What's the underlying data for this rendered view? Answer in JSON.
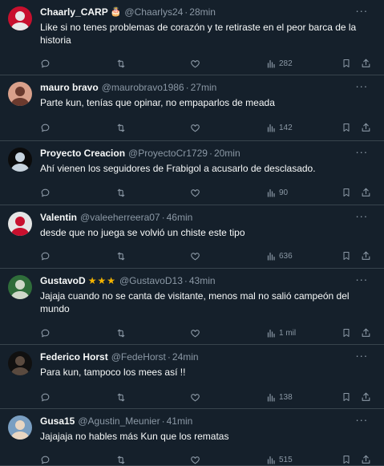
{
  "tweets": [
    {
      "name": "Chaarly_CARP",
      "badge": "🎂",
      "handle": "@Chaarlys24",
      "separator": "·",
      "time": "28min",
      "text": "Like si no tenes problemas de corazón y te retiraste en el peor barca de la historia",
      "views": "282",
      "avatar_colors": [
        "#c8102e",
        "#e8e8e8"
      ]
    },
    {
      "name": "mauro bravo",
      "badge": "",
      "handle": "@maurobravo1986",
      "separator": "·",
      "time": "27min",
      "text": "Parte kun, tenías que opinar, no empaparlos de meada",
      "views": "142",
      "avatar_colors": [
        "#d9a08b",
        "#6b3a2e"
      ]
    },
    {
      "name": "Proyecto Creacion",
      "badge": "",
      "handle": "@ProyectoCr1729",
      "separator": "·",
      "time": "20min",
      "text": "Ahí vienen los seguidores de Frabigol a acusarlo de desclasado.",
      "views": "90",
      "avatar_colors": [
        "#0b0b0b",
        "#c7d3dd"
      ]
    },
    {
      "name": "Valentin",
      "badge": "",
      "handle": "@valeeherreera07",
      "separator": "·",
      "time": "46min",
      "text": "desde que no  juega se volvió un chiste este tipo",
      "views": "636",
      "avatar_colors": [
        "#e5e5e5",
        "#c8102e"
      ]
    },
    {
      "name": "GustavoD",
      "badge": "★★★",
      "handle": "@GustavoD13",
      "separator": "·",
      "time": "43min",
      "text": "Jajaja cuando no se canta de visitante, menos mal no salió campeón del mundo",
      "views": "1 mil",
      "avatar_colors": [
        "#2f6d3a",
        "#cfd9c9"
      ]
    },
    {
      "name": "Federico Horst",
      "badge": "",
      "handle": "@FedeHorst",
      "separator": "·",
      "time": "24min",
      "text": "Para kun, tampoco los mees así !!",
      "views": "138",
      "avatar_colors": [
        "#101010",
        "#5a4a3f"
      ]
    },
    {
      "name": "Gusa15",
      "badge": "",
      "handle": "@Agustin_Meunier",
      "separator": "·",
      "time": "41min",
      "text": "Jajajaja no hables más Kun que los rematas",
      "views": "515",
      "avatar_colors": [
        "#7a9fc2",
        "#e9d6c2"
      ]
    }
  ],
  "icons": {
    "reply": "reply-icon",
    "retweet": "retweet-icon",
    "like": "like-icon",
    "views": "views-icon",
    "bookmark": "bookmark-icon",
    "share": "share-icon",
    "more": "more-icon"
  },
  "colors": {
    "background": "#15202b",
    "divider": "#38444d",
    "muted": "#8b98a5",
    "text": "#f7f9f9",
    "star": "#f5b400"
  }
}
